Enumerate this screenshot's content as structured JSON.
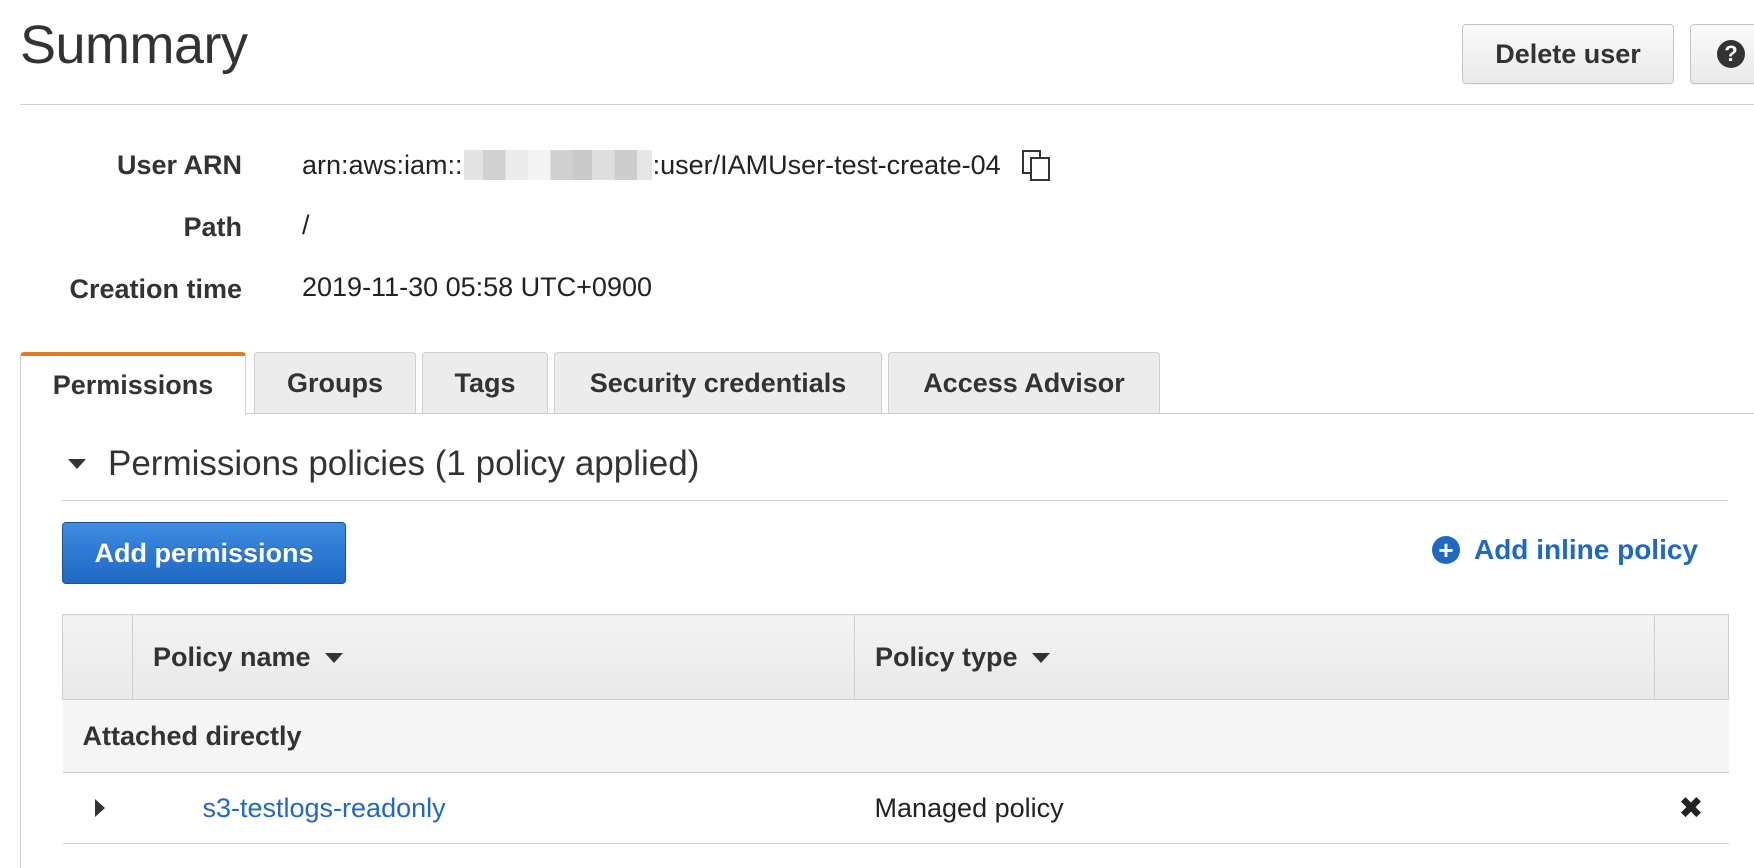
{
  "header": {
    "title": "Summary",
    "delete_label": "Delete user",
    "help_glyph": "?"
  },
  "summary": {
    "fields": [
      {
        "label": "User ARN",
        "value_prefix": "arn:aws:iam::",
        "value_suffix": ":user/IAMUser-test-create-04"
      },
      {
        "label": "Path",
        "value": "/"
      },
      {
        "label": "Creation time",
        "value": "2019-11-30 05:58 UTC+0900"
      }
    ]
  },
  "tabs": [
    {
      "label": "Permissions",
      "active": true
    },
    {
      "label": "Groups",
      "active": false
    },
    {
      "label": "Tags",
      "active": false
    },
    {
      "label": "Security credentials",
      "active": false
    },
    {
      "label": "Access Advisor",
      "active": false
    }
  ],
  "permissions": {
    "section_title": "Permissions policies (1 policy applied)",
    "add_permissions_label": "Add permissions",
    "add_inline_label": "Add inline policy",
    "columns": [
      "Policy name",
      "Policy type"
    ],
    "group_label": "Attached directly",
    "rows": [
      {
        "name": "s3-testlogs-readonly",
        "type": "Managed policy",
        "remove_glyph": "✖"
      }
    ]
  },
  "colors": {
    "accent_tab": "#e07b26",
    "primary_button": "#1f68c3",
    "link": "#1f68c3"
  }
}
